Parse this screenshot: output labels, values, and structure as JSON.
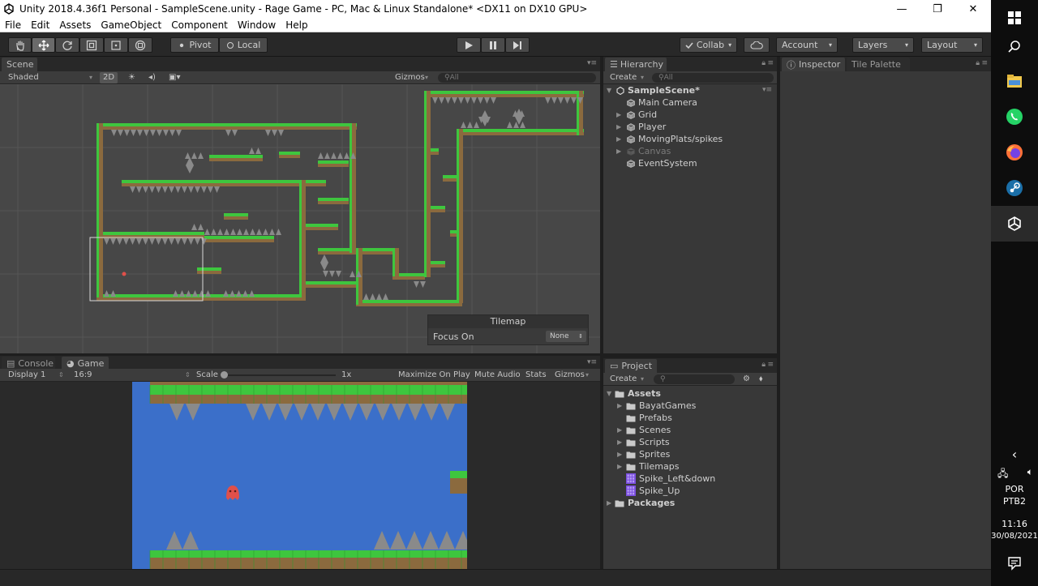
{
  "window": {
    "title": "Unity 2018.4.36f1 Personal - SampleScene.unity - Rage Game - PC, Mac & Linux Standalone* <DX11 on DX10 GPU>",
    "minimize": "—",
    "restore": "❐",
    "close": "✕"
  },
  "menu": [
    "File",
    "Edit",
    "Assets",
    "GameObject",
    "Component",
    "Window",
    "Help"
  ],
  "toolbar": {
    "pivot": "Pivot",
    "local": "Local",
    "collab": "Collab",
    "account": "Account",
    "layers": "Layers",
    "layout": "Layout"
  },
  "scene": {
    "tab": "Scene",
    "shading": "Shaded",
    "mode_2d": "2D",
    "gizmos": "Gizmos",
    "search_placeholder": "All",
    "overlay_title": "Tilemap",
    "focus_label": "Focus On",
    "focus_value": "None"
  },
  "hierarchy": {
    "tab": "Hierarchy",
    "create": "Create",
    "search_placeholder": "All",
    "scene_name": "SampleScene*",
    "items": [
      {
        "label": "Main Camera",
        "expandable": false,
        "dimmed": false
      },
      {
        "label": "Grid",
        "expandable": true,
        "dimmed": false
      },
      {
        "label": "Player",
        "expandable": true,
        "dimmed": false
      },
      {
        "label": "MovingPlats/spikes",
        "expandable": true,
        "dimmed": false
      },
      {
        "label": "Canvas",
        "expandable": true,
        "dimmed": true
      },
      {
        "label": "EventSystem",
        "expandable": false,
        "dimmed": false
      }
    ]
  },
  "inspector": {
    "tab": "Inspector",
    "tab2": "Tile Palette"
  },
  "console": {
    "tab": "Console"
  },
  "game": {
    "tab": "Game",
    "display": "Display 1",
    "aspect": "16:9",
    "scale_label": "Scale",
    "scale_value": "1x",
    "maximize": "Maximize On Play",
    "mute": "Mute Audio",
    "stats": "Stats",
    "gizmos": "Gizmos"
  },
  "project": {
    "tab": "Project",
    "create": "Create",
    "root": "Assets",
    "items": [
      {
        "label": "BayatGames",
        "type": "folder",
        "expandable": true
      },
      {
        "label": "Prefabs",
        "type": "folder",
        "expandable": false
      },
      {
        "label": "Scenes",
        "type": "folder",
        "expandable": true
      },
      {
        "label": "Scripts",
        "type": "folder",
        "expandable": true
      },
      {
        "label": "Sprites",
        "type": "folder",
        "expandable": true
      },
      {
        "label": "Tilemaps",
        "type": "folder",
        "expandable": true
      },
      {
        "label": "Spike_Left&down",
        "type": "asset",
        "expandable": false
      },
      {
        "label": "Spike_Up",
        "type": "asset",
        "expandable": false
      }
    ],
    "packages": "Packages"
  },
  "taskbar": {
    "lang1": "POR",
    "lang2": "PTB2",
    "time": "11:16",
    "date": "30/08/2021"
  },
  "colors": {
    "grass": "#3ec63e",
    "dirt": "#8b6a3e",
    "sky": "#3b6fc9",
    "spike": "#8a8a8a",
    "player": "#e0504a"
  }
}
